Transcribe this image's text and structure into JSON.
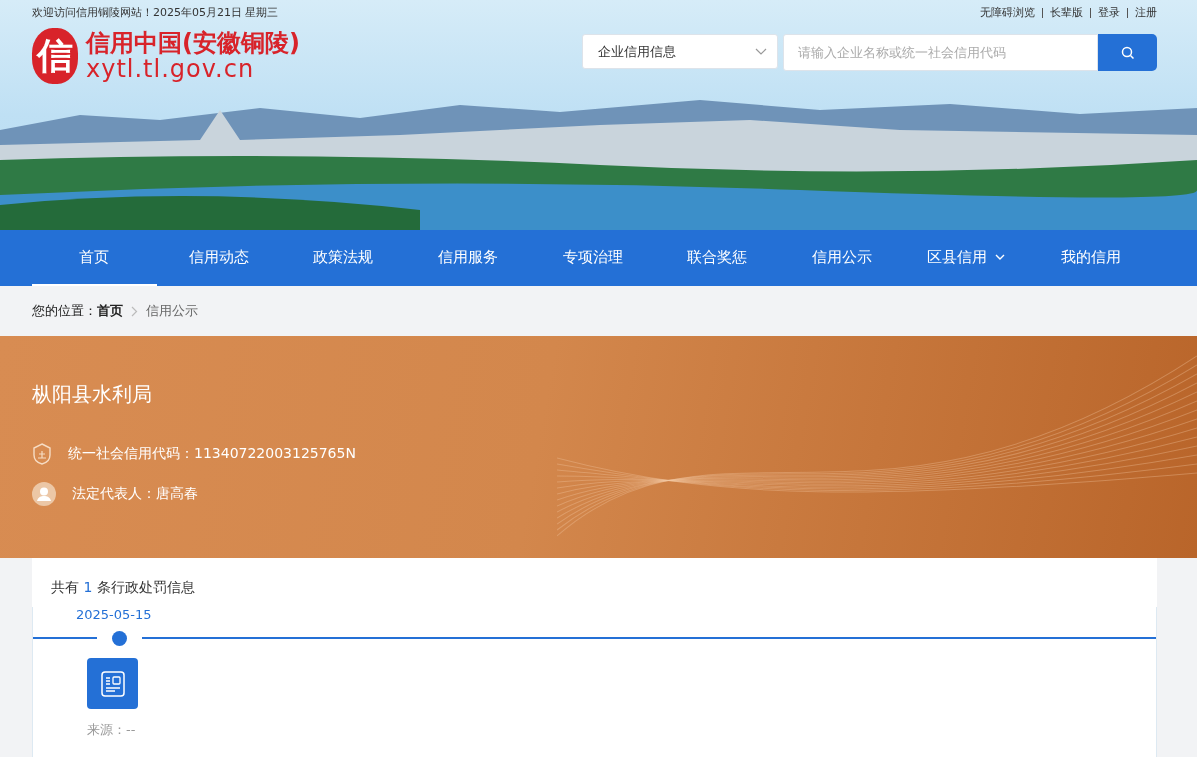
{
  "top_bar": {
    "greeting": "欢迎访问信用铜陵网站！2025年05月21日 星期三",
    "links": [
      "无障碍浏览",
      "长辈版",
      "登录",
      "注册"
    ]
  },
  "logo": {
    "mark": "信",
    "title": "信用中国(安徽铜陵)",
    "domain": "xytl.tl.gov.cn"
  },
  "search": {
    "category": "企业信用信息",
    "placeholder": "请输入企业名称或统一社会信用代码"
  },
  "nav": [
    {
      "label": "首页",
      "selected": true,
      "has_menu": false
    },
    {
      "label": "信用动态",
      "selected": false,
      "has_menu": false
    },
    {
      "label": "政策法规",
      "selected": false,
      "has_menu": false
    },
    {
      "label": "信用服务",
      "selected": false,
      "has_menu": false
    },
    {
      "label": "专项治理",
      "selected": false,
      "has_menu": false
    },
    {
      "label": "联合奖惩",
      "selected": false,
      "has_menu": false
    },
    {
      "label": "信用公示",
      "selected": false,
      "has_menu": false
    },
    {
      "label": "区县信用",
      "selected": false,
      "has_menu": true
    },
    {
      "label": "我的信用",
      "selected": false,
      "has_menu": false
    }
  ],
  "breadcrumb": {
    "prefix": "您的位置：",
    "items": [
      "首页",
      "信用公示"
    ]
  },
  "entity": {
    "name": "枞阳县水利局",
    "credit_code": "统一社会信用代码：11340722003125765N",
    "representative": "法定代表人：唐高春"
  },
  "records": {
    "count_prefix": "共有",
    "count": "1",
    "count_suffix": "条行政处罚信息",
    "timeline": [
      {
        "date": "2025-05-15",
        "source": "来源：--"
      }
    ]
  }
}
